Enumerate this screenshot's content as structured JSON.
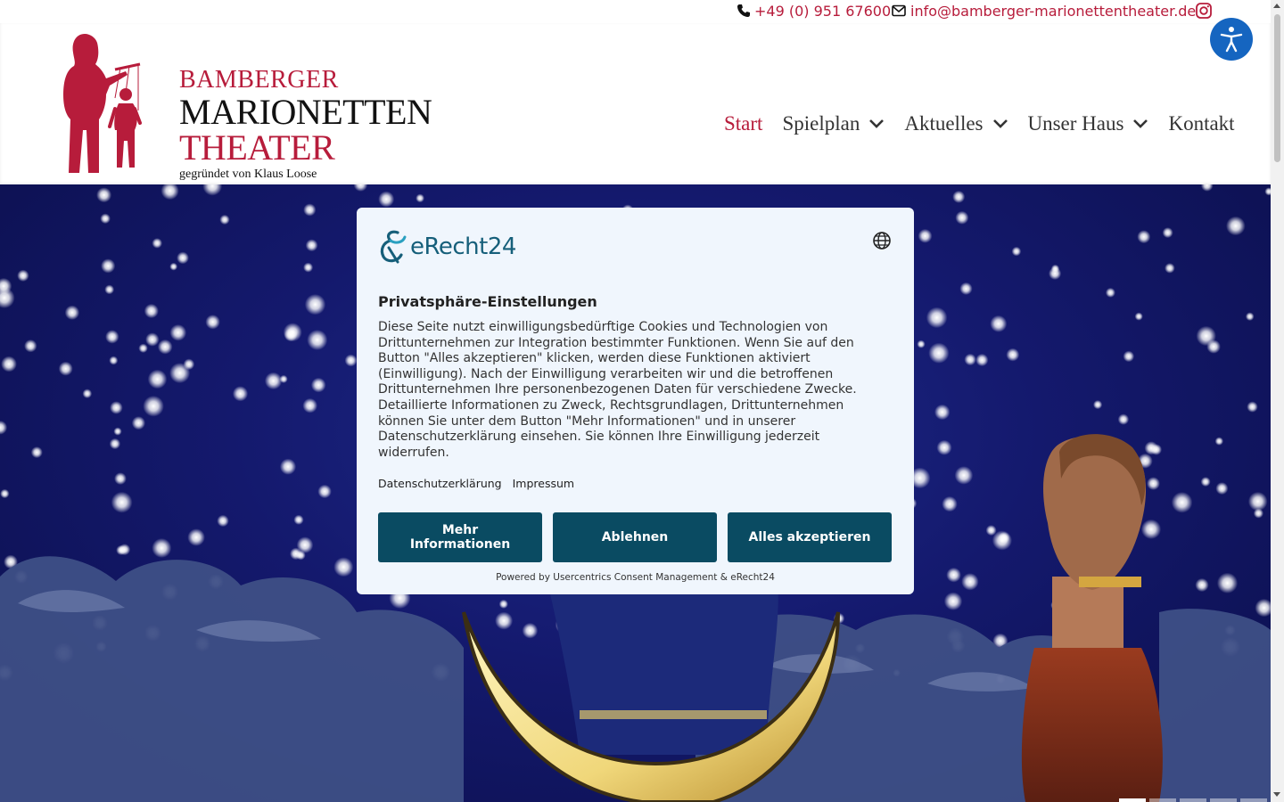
{
  "topbar": {
    "phone": "+49 (0) 951 67600",
    "email": "info@bamberger-marionettentheater.de",
    "icons": {
      "phone": "phone-icon",
      "email": "envelope-icon",
      "social": "instagram-icon"
    }
  },
  "header": {
    "logo": {
      "line1": "BAMBERGER",
      "line2": "MARIONETTEN",
      "line3": "THEATER",
      "line4": "gegründet von Klaus Loose"
    },
    "nav": [
      {
        "label": "Start",
        "active": true,
        "has_dropdown": false
      },
      {
        "label": "Spielplan",
        "active": false,
        "has_dropdown": true
      },
      {
        "label": "Aktuelles",
        "active": false,
        "has_dropdown": true
      },
      {
        "label": "Unser Haus",
        "active": false,
        "has_dropdown": true
      },
      {
        "label": "Kontakt",
        "active": false,
        "has_dropdown": false
      }
    ],
    "accessibility_icon": "accessibility-person-icon"
  },
  "consent": {
    "brand": "eRecht24",
    "title": "Privatsphäre-Einstellungen",
    "body": "Diese Seite nutzt einwilligungsbedürftige Cookies und Technologien von Drittunternehmen zur Integration bestimmter Funktionen. Wenn Sie auf den Button \"Alles akzeptieren\" klicken, werden diese Funktionen aktiviert (Einwilligung). Nach der Einwilligung verarbeiten wir und die betroffenen Drittunternehmen Ihre personenbezogenen Daten für verschiedene Zwecke. Detaillierte Informationen zu Zweck, Rechtsgrundlagen, Drittunternehmen können Sie unter dem Button \"Mehr Informationen\" und in unserer Datenschutzerklärung einsehen. Sie können Ihre Einwilligung jederzeit widerrufen.",
    "links": {
      "privacy": "Datenschutzerklärung",
      "imprint": "Impressum"
    },
    "buttons": {
      "more": "Mehr Informationen",
      "decline": "Ablehnen",
      "accept": "Alles akzeptieren"
    },
    "powered_by": "Powered by Usercentrics Consent Management & eRecht24"
  },
  "hero": {
    "slides_total": 5,
    "slide_active": 1
  },
  "colors": {
    "brand_red": "#b71c3b",
    "button_teal": "#0a4b62",
    "modal_bg": "#f0f6fd",
    "accessibility_blue": "#1565c0",
    "night_sky": "#14196d"
  }
}
